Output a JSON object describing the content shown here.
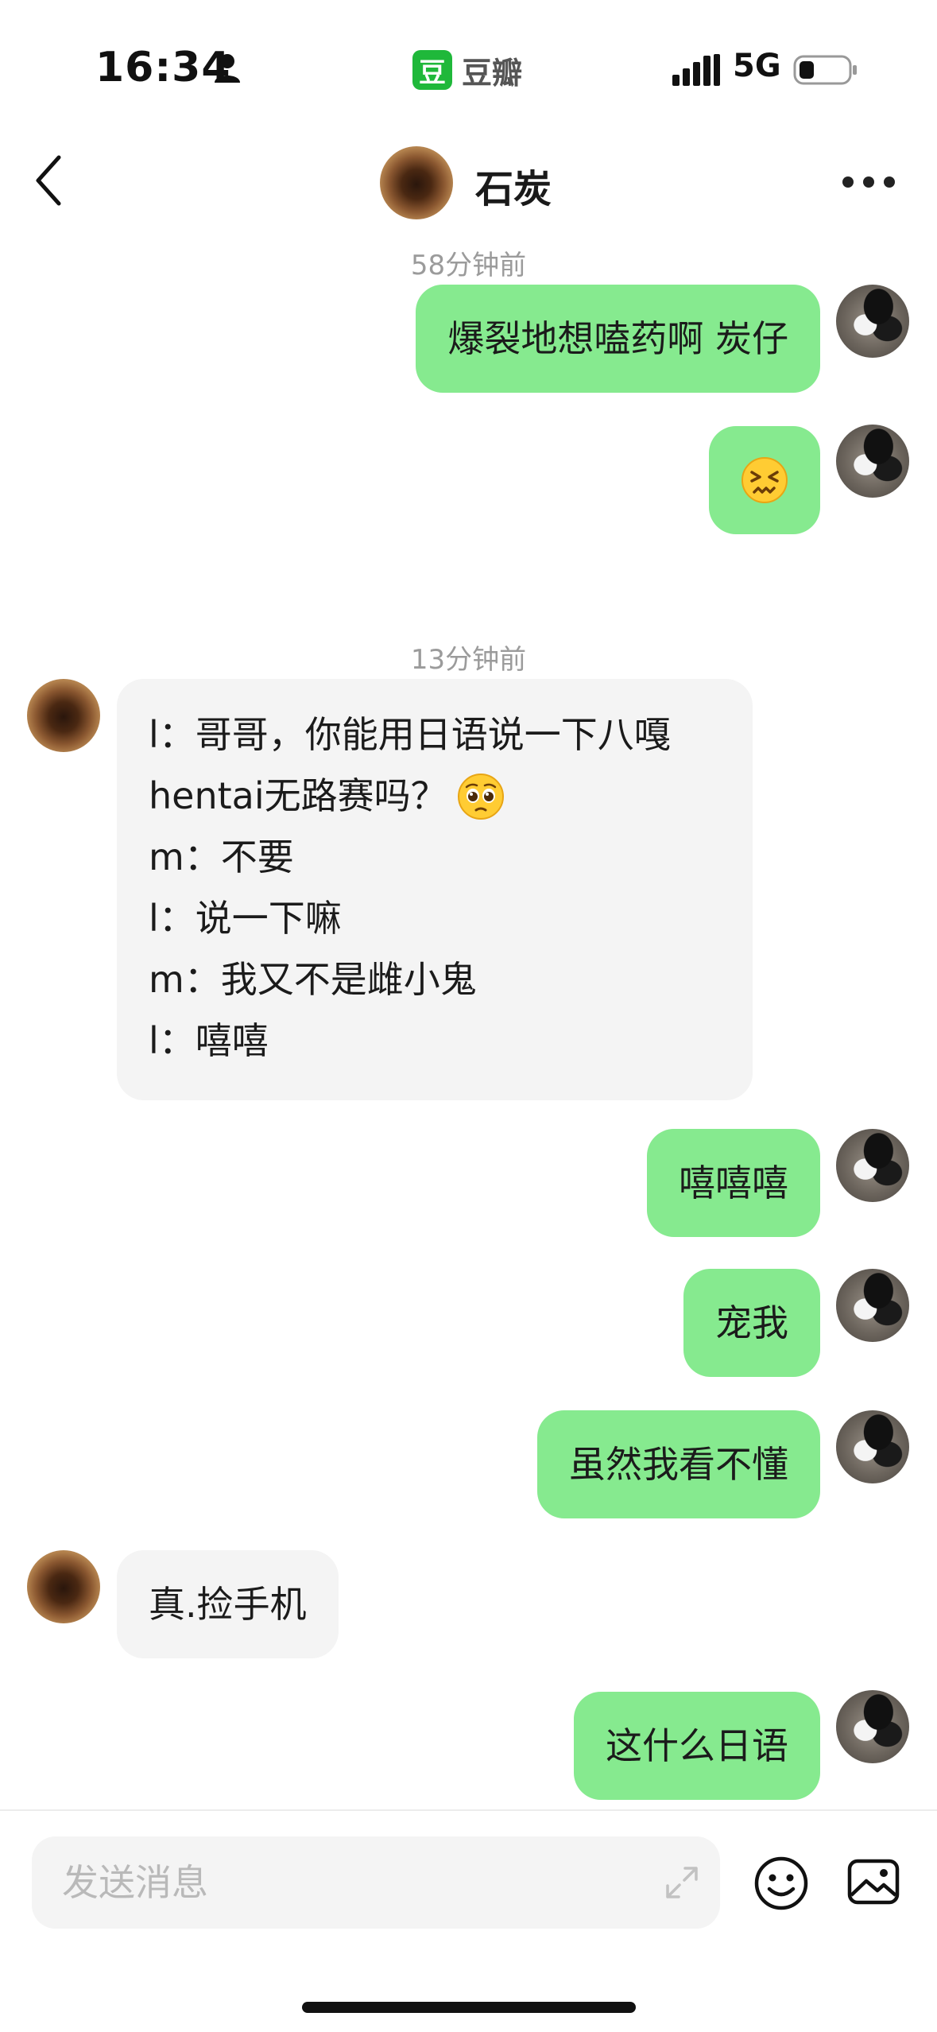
{
  "status_bar": {
    "time": "16:34",
    "app_logo_char": "豆",
    "app_name": "豆瓣",
    "network": "5G"
  },
  "header": {
    "contact_name": "石炭"
  },
  "messages": [
    {
      "type": "timestamp",
      "text": "58分钟前"
    },
    {
      "type": "outgoing",
      "text": "爆裂地想嗑药啊 炭仔"
    },
    {
      "type": "outgoing",
      "emoji": "confounded-face-emoji"
    },
    {
      "type": "timestamp",
      "text": "13分钟前"
    },
    {
      "type": "incoming",
      "lines": [
        "l：哥哥，你能用日语说一下八嘎",
        "hentai无路赛吗？",
        "m：不要",
        "l：说一下嘛",
        "m：我又不是雌小鬼",
        "l：嘻嘻"
      ],
      "line2_emoji": "pleading-face-emoji"
    },
    {
      "type": "outgoing",
      "text": "嘻嘻嘻"
    },
    {
      "type": "outgoing",
      "text": "宠我"
    },
    {
      "type": "outgoing",
      "text": "虽然我看不懂"
    },
    {
      "type": "incoming",
      "text": "真.捡手机"
    },
    {
      "type": "outgoing",
      "text": "这什么日语"
    }
  ],
  "input": {
    "placeholder": "发送消息"
  },
  "colors": {
    "outgoing_bubble": "#86ea8f",
    "incoming_bubble": "#f4f4f4",
    "app_green": "#1fb83a"
  }
}
